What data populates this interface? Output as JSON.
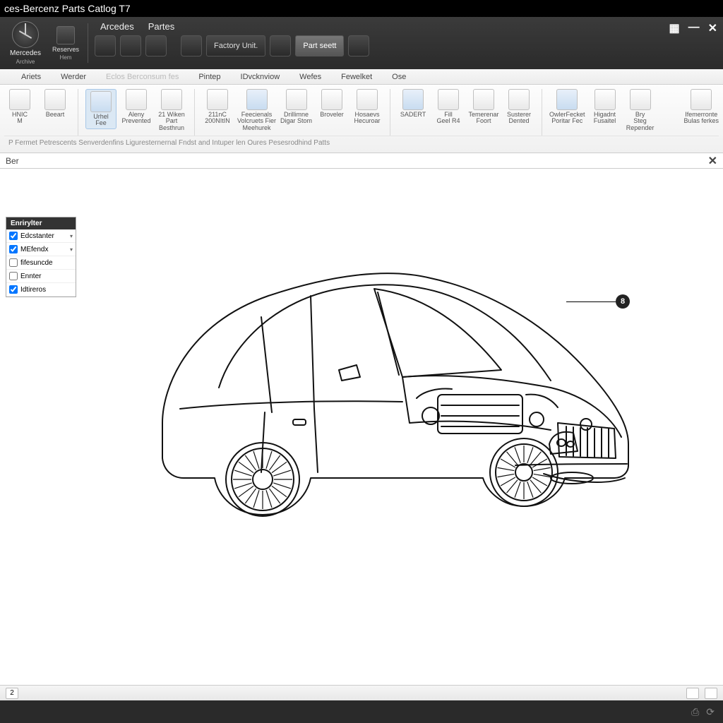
{
  "title": "ces-Bercenz Parts Catlog T7",
  "brand_main": {
    "name": "Mercedes",
    "sub": "Archive"
  },
  "brand_side": {
    "name": "Reserves",
    "sub": "Hem"
  },
  "dark_tabs": [
    "Arcedes",
    "Partes"
  ],
  "dark_buttons": {
    "factory": "Factory Unit.",
    "partsearch": "Part seett"
  },
  "menubar": [
    "Ariets",
    "Werder",
    "Eclos Berconsum fes",
    "Pintep",
    "IDvcknviow",
    "Wefes",
    "Fewelket",
    "Ose"
  ],
  "ribbon": [
    {
      "label": "HNIC\nM",
      "sel": false
    },
    {
      "label": "Beeart",
      "sel": false
    },
    {
      "label": "Urhel\nFee",
      "sel": true
    },
    {
      "label": "Aleny\nPrevented",
      "sel": false
    },
    {
      "label": "21 Wiken\nPart\nBesthrun",
      "sel": false
    },
    {
      "label": "211nC\n200NItIN",
      "sel": false
    },
    {
      "label": "Feecienals\nVolcruets Fier\nMeehurek",
      "sel": false
    },
    {
      "label": "Drillimne\nDigar Stom",
      "sel": false
    },
    {
      "label": "Broveler",
      "sel": false
    },
    {
      "label": "Hosaevs\nHecuroar",
      "sel": false
    },
    {
      "label": "SADERT",
      "sel": false
    },
    {
      "label": "Fill\nGeel R4",
      "sel": false
    },
    {
      "label": "Temerenar\nFoort",
      "sel": false
    },
    {
      "label": "Susterer\nDented",
      "sel": false
    },
    {
      "label": "OwlerFecket\nPoritar Fec",
      "sel": false
    },
    {
      "label": "Higadnt\nFusaitel",
      "sel": false
    },
    {
      "label": "Bry\nSteg\nRepender",
      "sel": false
    }
  ],
  "ribbon_right": {
    "label": "Ifemerronte\nBulas ferkes"
  },
  "breadcrumb": "P Fermet Petrescents Senverdenfins Liguresternernal Fndst and Intuper len Oures Pesesrodhind Patts",
  "subheader": {
    "label": "Ber"
  },
  "filter": {
    "header": "Enrirylter",
    "rows": [
      {
        "label": "Edcstanter",
        "checked": true,
        "dropdown": true
      },
      {
        "label": "MEfendx",
        "checked": true,
        "dropdown": true
      },
      {
        "label": "fifesuncde",
        "checked": false,
        "dropdown": false
      },
      {
        "label": "Ennter",
        "checked": false,
        "dropdown": false
      },
      {
        "label": "Idtireros",
        "checked": true,
        "dropdown": false
      }
    ]
  },
  "callout_num": "8",
  "status_left": "2"
}
